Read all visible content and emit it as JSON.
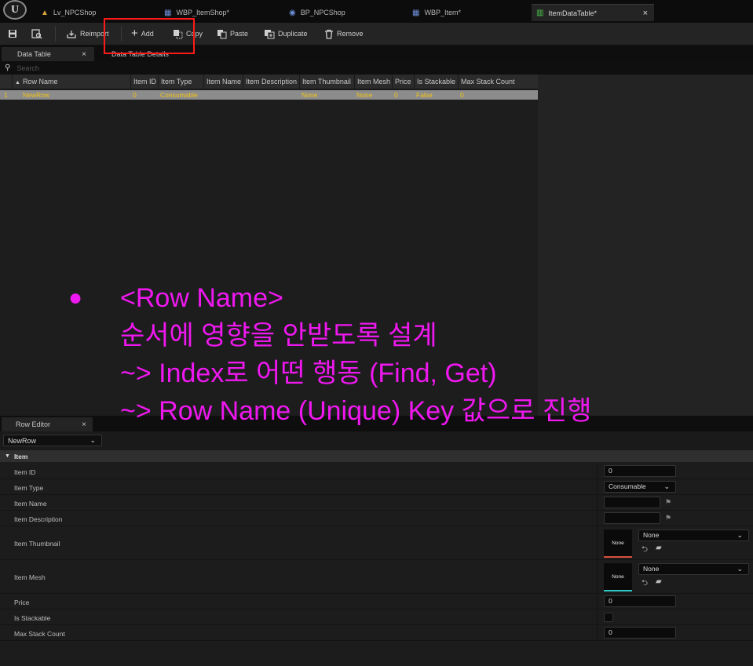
{
  "doc_tabs": [
    {
      "label": "Lv_NPCShop",
      "icon": "level-icon"
    },
    {
      "label": "WBP_ItemShop*",
      "icon": "widget-blueprint-icon"
    },
    {
      "label": "BP_NPCShop",
      "icon": "blueprint-icon"
    },
    {
      "label": "WBP_Item*",
      "icon": "widget-blueprint-icon"
    },
    {
      "label": "ItemDataTable*",
      "icon": "data-table-icon",
      "active": true
    }
  ],
  "toolbar": {
    "reimport": "Reimport",
    "add": "Add",
    "copy": "Copy",
    "paste": "Paste",
    "duplicate": "Duplicate",
    "remove": "Remove"
  },
  "panel_tabs": {
    "data_table": "Data Table",
    "details": "Data Table Details"
  },
  "search": {
    "placeholder": "Search"
  },
  "table": {
    "columns": [
      "Row Name",
      "Item ID",
      "Item Type",
      "Item Name",
      "Item Description",
      "Item Thumbnail",
      "Item Mesh",
      "Price",
      "Is Stackable",
      "Max Stack Count"
    ],
    "row": {
      "index": "1",
      "cells": [
        "NewRow",
        "0",
        "Consumable",
        "",
        "",
        "None",
        "None",
        "0",
        "False",
        "0"
      ]
    }
  },
  "annotation": {
    "bullet": "●",
    "lines": [
      "<Row Name>",
      "순서에 영향을 안받도록 설계",
      "~> Index로 어떤 행동 (Find, Get)",
      "~> Row Name (Unique) Key 값으로 진행"
    ],
    "color": "#f018f0"
  },
  "row_editor": {
    "tab_label": "Row Editor",
    "selected_row": "NewRow",
    "category": "Item",
    "props": {
      "item_id": {
        "label": "Item ID",
        "value": "0"
      },
      "item_type": {
        "label": "Item Type",
        "value": "Consumable"
      },
      "item_name": {
        "label": "Item Name",
        "value": ""
      },
      "item_description": {
        "label": "Item Description",
        "value": ""
      },
      "item_thumbnail": {
        "label": "Item Thumbnail",
        "thumb": "None",
        "value": "None"
      },
      "item_mesh": {
        "label": "Item Mesh",
        "thumb": "None",
        "value": "None"
      },
      "price": {
        "label": "Price",
        "value": "0"
      },
      "is_stackable": {
        "label": "Is Stackable",
        "checked": false
      },
      "max_stack_count": {
        "label": "Max Stack Count",
        "value": "0"
      }
    }
  },
  "colors": {
    "row_text": "#f3c414",
    "selection_box": "#ff1a1a",
    "thumbnail_underline": "#d8503c",
    "mesh_underline": "#2fc8c8"
  }
}
